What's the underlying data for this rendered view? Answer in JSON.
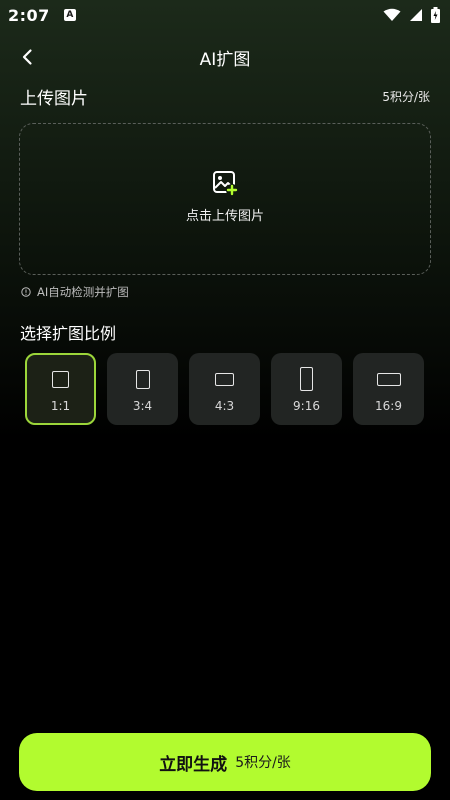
{
  "status_bar": {
    "time": "2:07",
    "notification_letter": "A"
  },
  "header": {
    "title": "AI扩图"
  },
  "upload_section": {
    "title": "上传图片",
    "price": "5积分/张",
    "upload_label": "点击上传图片",
    "hint": "AI自动检测并扩图"
  },
  "ratio_section": {
    "title": "选择扩图比例",
    "options": [
      {
        "label": "1:1",
        "selected": true
      },
      {
        "label": "3:4",
        "selected": false
      },
      {
        "label": "4:3",
        "selected": false
      },
      {
        "label": "9:16",
        "selected": false
      },
      {
        "label": "16:9",
        "selected": false
      }
    ]
  },
  "generate_button": {
    "label": "立即生成",
    "price": "5积分/张"
  },
  "colors": {
    "accent": "#b2fb2f",
    "selected_border": "#9cd63a",
    "background": "#000000"
  }
}
